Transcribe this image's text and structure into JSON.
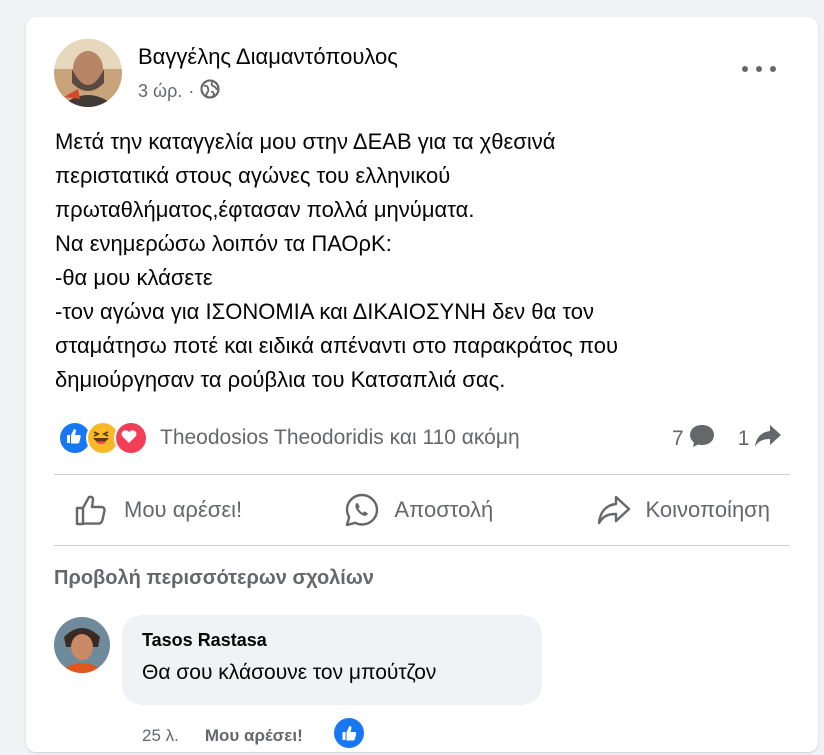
{
  "post": {
    "author": "Βαγγέλης Διαμαντόπουλος",
    "time": "3 ώρ.",
    "separator": "·",
    "privacy_icon": "globe-icon",
    "more_icon": "more-horizontal-icon",
    "lines": [
      "Μετά την καταγγελία μου στην ΔΕΑΒ για τα χθεσινά",
      "περιστατικά στους αγώνες του ελληνικού",
      "πρωταθλήματος,έφτασαν πολλά μηνύματα.",
      "Να ενημερώσω λοιπόν τα ΠΑΟρΚ:",
      "-θα μου κλάσετε",
      "-τον αγώνα για ΙΣΟΝΟΜΙΑ και ΔΙΚΑΙΟΣΥΝΗ δεν θα τον",
      "σταμάτησω ποτέ και ειδικά απέναντι στο παρακράτος που",
      "δημιούργησαν τα ρούβλια του Κατσαπλιά σας."
    ]
  },
  "reactions": {
    "icons": [
      "like-reaction-icon",
      "haha-reaction-icon",
      "love-reaction-icon"
    ],
    "summary": "Theodosios Theodoridis και 110 ακόμη",
    "comment_count": "7",
    "share_count": "1"
  },
  "actions": {
    "like": "Μου αρέσει!",
    "send": "Αποστολή",
    "share": "Κοινοποίηση"
  },
  "comments": {
    "view_more": "Προβολή περισσότερων σχολίων",
    "items": [
      {
        "author": "Tasos Rastasa",
        "text": "Θα σου κλάσουνε τον μπούτζον",
        "time": "25 λ.",
        "like_label": "Μου αρέσει!"
      }
    ]
  },
  "colors": {
    "like_blue": "#1877f2",
    "love_red": "#f33e58",
    "haha_yellow": "#f7b928",
    "secondary_text": "#65676b"
  }
}
